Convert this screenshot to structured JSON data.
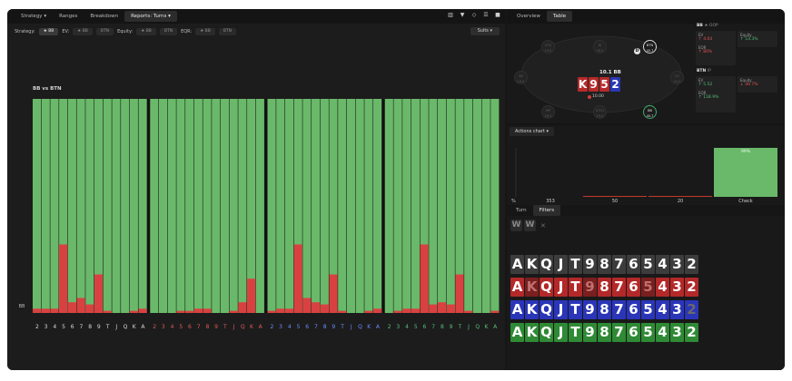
{
  "toolbar": {
    "tabs": [
      "Strategy",
      "Ranges",
      "Breakdown",
      "Reports: Turns"
    ],
    "tab_carets": [
      "▾",
      "",
      "",
      "▾"
    ],
    "active_tab": 3
  },
  "filters": {
    "strategy_label": "Strategy:",
    "strategy_chips": [
      "★ BB"
    ],
    "ev_label": "EV:",
    "ev_chips": [
      "★ BB",
      "BTN"
    ],
    "equity_label": "Equity:",
    "equity_chips": [
      "★ BB",
      "BTN"
    ],
    "eqr_label": "EQR:",
    "eqr_chips": [
      "★ BB",
      "BTN"
    ],
    "suits_label": "Suits ▾"
  },
  "chart_data": {
    "type": "bar",
    "title": "BB vs BTN",
    "y_axis_label": "BB",
    "ylim": [
      0,
      100
    ],
    "groups": [
      {
        "suit_color": "#d9d9d9",
        "categories": [
          "2",
          "3",
          "4",
          "5",
          "6",
          "7",
          "8",
          "9",
          "T",
          "J",
          "Q",
          "K",
          "A"
        ]
      },
      {
        "suit_color": "#e05a5a",
        "categories": [
          "2",
          "3",
          "4",
          "5",
          "6",
          "7",
          "8",
          "9",
          "T",
          "J",
          "Q",
          "K",
          "A"
        ]
      },
      {
        "suit_color": "#6b8cff",
        "categories": [
          "2",
          "3",
          "4",
          "5",
          "6",
          "7",
          "8",
          "9",
          "T",
          "J",
          "Q",
          "K",
          "A"
        ]
      },
      {
        "suit_color": "#55c07a",
        "categories": [
          "2",
          "3",
          "4",
          "5",
          "6",
          "7",
          "8",
          "9",
          "T",
          "J",
          "Q",
          "K",
          "A"
        ]
      }
    ],
    "series": [
      {
        "values": [
          100,
          100,
          100,
          100,
          100,
          100,
          100,
          100,
          100,
          100,
          100,
          100,
          100,
          100,
          100,
          100,
          100,
          100,
          100,
          100,
          100,
          100,
          100,
          100,
          100,
          100,
          100,
          100,
          100,
          100,
          100,
          100,
          100,
          100,
          100,
          100,
          100,
          100,
          100,
          100,
          100,
          100,
          100,
          100,
          100,
          100,
          100,
          100,
          100,
          100,
          100,
          100
        ],
        "color": "#6ab96a"
      },
      {
        "values": [
          2,
          2,
          2,
          32,
          5,
          7,
          4,
          18,
          1,
          0,
          0,
          1,
          2,
          0,
          0,
          0,
          1,
          1,
          2,
          2,
          0,
          0,
          1,
          5,
          16,
          0,
          1,
          2,
          2,
          32,
          7,
          5,
          4,
          18,
          1,
          0,
          0,
          1,
          2,
          0,
          1,
          2,
          2,
          32,
          4,
          5,
          4,
          18,
          1,
          0,
          0,
          1,
          2
        ],
        "color": "#d94141"
      }
    ]
  },
  "right_tabs": [
    "Overview",
    "Table"
  ],
  "right_active": 1,
  "table": {
    "seats": [
      {
        "name": "UTG",
        "stack": "19.0"
      },
      {
        "name": "HJ",
        "stack": "18.0"
      },
      {
        "name": "SB",
        "stack": "19.0"
      },
      {
        "name": "CO",
        "stack": "20.0"
      },
      {
        "name": "MP",
        "stack": "18.5"
      },
      {
        "name": "UTG1",
        "stack": "19.0"
      }
    ],
    "btn": {
      "name": "BTN",
      "stack": "40.7"
    },
    "bb": {
      "name": "BB",
      "stack": "40.7"
    },
    "dealer": "D",
    "pot": "10.1 BB",
    "board": [
      {
        "rank": "K",
        "color": "#b52a2a"
      },
      {
        "rank": "9",
        "color": "#b52a2a"
      },
      {
        "rank": "5",
        "color": "#b52a2a"
      },
      {
        "rank": "2",
        "color": "#2a37b5"
      }
    ],
    "pot_chip": "10.00"
  },
  "stats": {
    "bb": {
      "title": "BB",
      "tag": "★ OOP",
      "ev_label": "EV",
      "ev_value": "↑ 4.04",
      "equity_label": "Equity",
      "equity_value": "↑ 53.3%",
      "eqr_label": "EQR",
      "eqr_value": "↑ 80%"
    },
    "btn": {
      "title": "BTN",
      "tag": "IP",
      "ev_label": "EV",
      "ev_value": "↑ 5.52",
      "equity_label": "Equity",
      "equity_value": "↓ 46.7%",
      "eqr_label": "EQR",
      "eqr_value": "↑ 118.9%"
    }
  },
  "actions_chart": {
    "title": "Actions chart ▾",
    "percent_label": "%",
    "total": "353",
    "bars": [
      {
        "label": "50",
        "value": 0.5,
        "color": "#c0392b"
      },
      {
        "label": "20",
        "value": 0.5,
        "color": "#c0392b"
      },
      {
        "label": "Check",
        "value": 100,
        "color": "#6ab96a",
        "top_label": "99%"
      }
    ]
  },
  "lower_tabs": [
    "Turn",
    "Filters"
  ],
  "lower_active": 1,
  "ww_buttons": [
    "W",
    "W"
  ],
  "close_glyph": "✕",
  "rank_rows": [
    {
      "style": "gray",
      "ranks": [
        "A",
        "K",
        "Q",
        "J",
        "T",
        "9",
        "8",
        "7",
        "6",
        "5",
        "4",
        "3",
        "2"
      ],
      "dim": []
    },
    {
      "style": "red",
      "ranks": [
        "A",
        "K",
        "Q",
        "J",
        "T",
        "9",
        "8",
        "7",
        "6",
        "5",
        "4",
        "3",
        "2"
      ],
      "dim": [
        1,
        5,
        9
      ]
    },
    {
      "style": "blue",
      "ranks": [
        "A",
        "K",
        "Q",
        "J",
        "T",
        "9",
        "8",
        "7",
        "6",
        "5",
        "4",
        "3",
        "2"
      ],
      "dim": [
        12
      ]
    },
    {
      "style": "green",
      "ranks": [
        "A",
        "K",
        "Q",
        "J",
        "T",
        "9",
        "8",
        "7",
        "6",
        "5",
        "4",
        "3",
        "2"
      ],
      "dim": []
    }
  ]
}
